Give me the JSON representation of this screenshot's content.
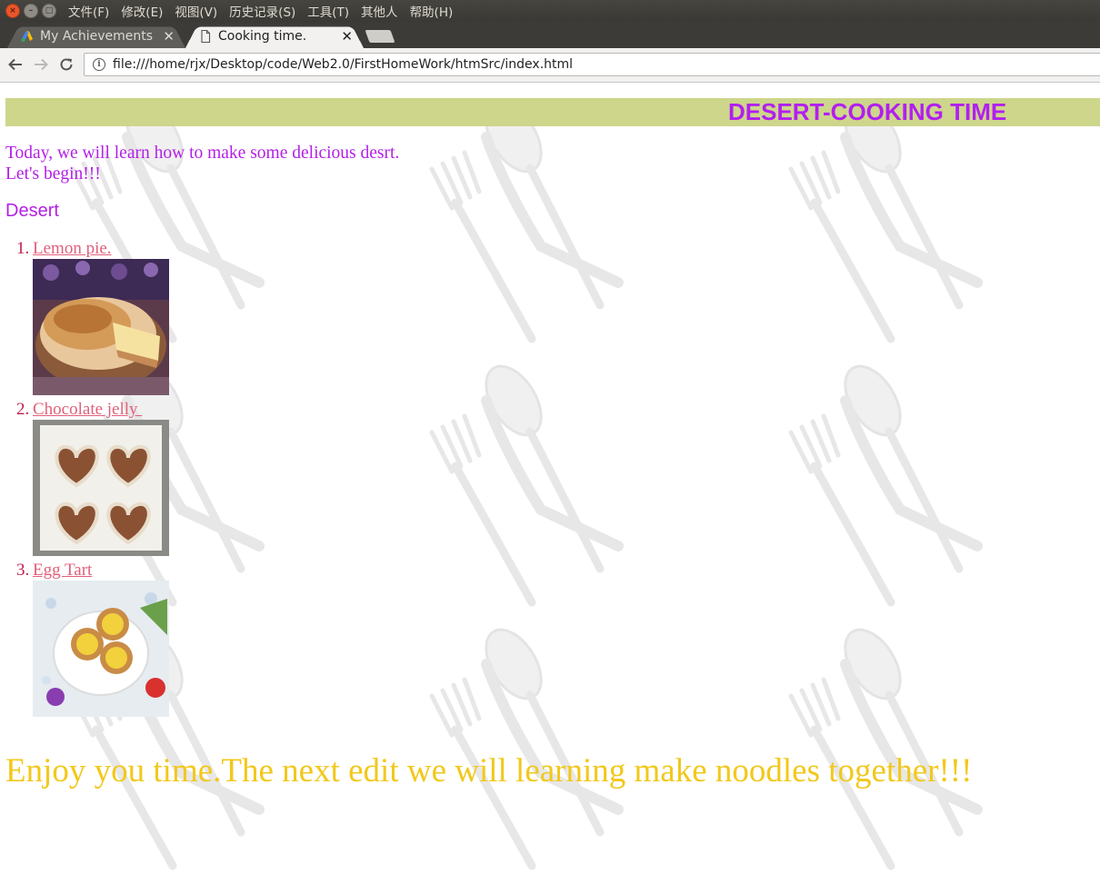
{
  "os_menubar": {
    "menus": [
      "文件(F)",
      "修改(E)",
      "视图(V)",
      "历史记录(S)",
      "工具(T)",
      "其他人",
      "帮助(H)"
    ]
  },
  "tabs": [
    {
      "title": "My Achievements",
      "favicon": "google-ads-logo-icon",
      "active": false
    },
    {
      "title": "Cooking time.",
      "favicon": "document-icon",
      "active": true
    }
  ],
  "toolbar": {
    "url": "file:///home/rjx/Desktop/code/Web2.0/FirstHomeWork/htmSrc/index.html"
  },
  "page": {
    "header_title": "DESERT-COOKING TIME",
    "intro_line1": "Today, we will learn how to make some delicious desrt.",
    "intro_line2": "Let's begin!!!",
    "section_heading": "Desert",
    "desserts": [
      {
        "number": "1.",
        "name": "Lemon pie.",
        "photo": "lemon-meringue-pie-photo"
      },
      {
        "number": "2.",
        "name": "Chocolate jelly ",
        "photo": "heart-chocolate-jelly-photo"
      },
      {
        "number": "3.",
        "name": "Egg Tart",
        "photo": "egg-tart-plate-photo"
      }
    ],
    "footer": "Enjoy you time.The next edit we will learning make noodles together!!!"
  },
  "colors": {
    "header_bar": "#cdd68a",
    "title": "#b21ff0",
    "intro": "#b31fe6",
    "link": "#e0607a",
    "list_number": "#c21d4a",
    "footer": "#f2c81b"
  }
}
